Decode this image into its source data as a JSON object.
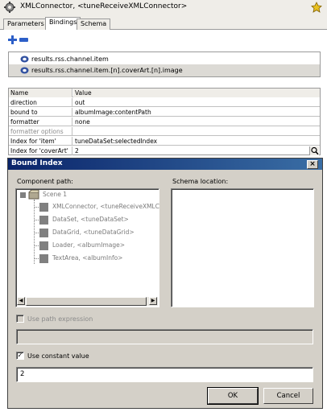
{
  "title_bar": {
    "title": "XMLConnector, <tuneReceiveXMLConnector>",
    "component_icon": "component-gear-icon",
    "pin_icon": "pin-icon"
  },
  "tabs": [
    "Parameters",
    "Bindings",
    "Schema"
  ],
  "bindings_toolbar": {
    "add_icon": "plus-icon",
    "remove_icon": "minus-icon",
    "accent_color": "#2d5fc8"
  },
  "bindings_list": [
    {
      "path": "results.rss.channel.item",
      "icon": "bidirectional-binding-icon"
    },
    {
      "path": "results.rss.channel.item.[n].coverArt.[n].image",
      "icon": "bidirectional-binding-icon",
      "selected": true
    }
  ],
  "property_grid": {
    "headers": {
      "name": "Name",
      "value": "Value"
    },
    "rows": [
      {
        "name": "direction",
        "value": "out"
      },
      {
        "name": "bound to",
        "value": "albumImage:contentPath"
      },
      {
        "name": "formatter",
        "value": "none"
      },
      {
        "name": "formatter options",
        "value": "",
        "disabled": true
      },
      {
        "name": "Index for 'item'",
        "value": "tuneDataSet:selectedIndex"
      },
      {
        "name": "Index for 'coverArt'",
        "value": "2"
      }
    ],
    "search_icon": "magnifier-icon"
  },
  "dialog": {
    "title": "Bound Index",
    "close_glyph": "×",
    "component_path_label": "Component path:",
    "schema_location_label": "Schema location:",
    "tree": {
      "root": "Scene 1",
      "children": [
        "XMLConnector, <tuneReceiveXMLC",
        "DataSet, <tuneDataSet>",
        "DataGrid, <tuneDataGrid>",
        "Loader, <albumImage>",
        "TextArea, <albumInfo>"
      ]
    },
    "use_path_expression_label": "Use path expression",
    "use_path_expression_checked": false,
    "use_constant_value_label": "Use constant value",
    "use_constant_value_checked": true,
    "constant_value": "2",
    "ok_label": "OK",
    "cancel_label": "Cancel",
    "title_gradient": [
      "#0a246a",
      "#3a6ea5"
    ]
  }
}
